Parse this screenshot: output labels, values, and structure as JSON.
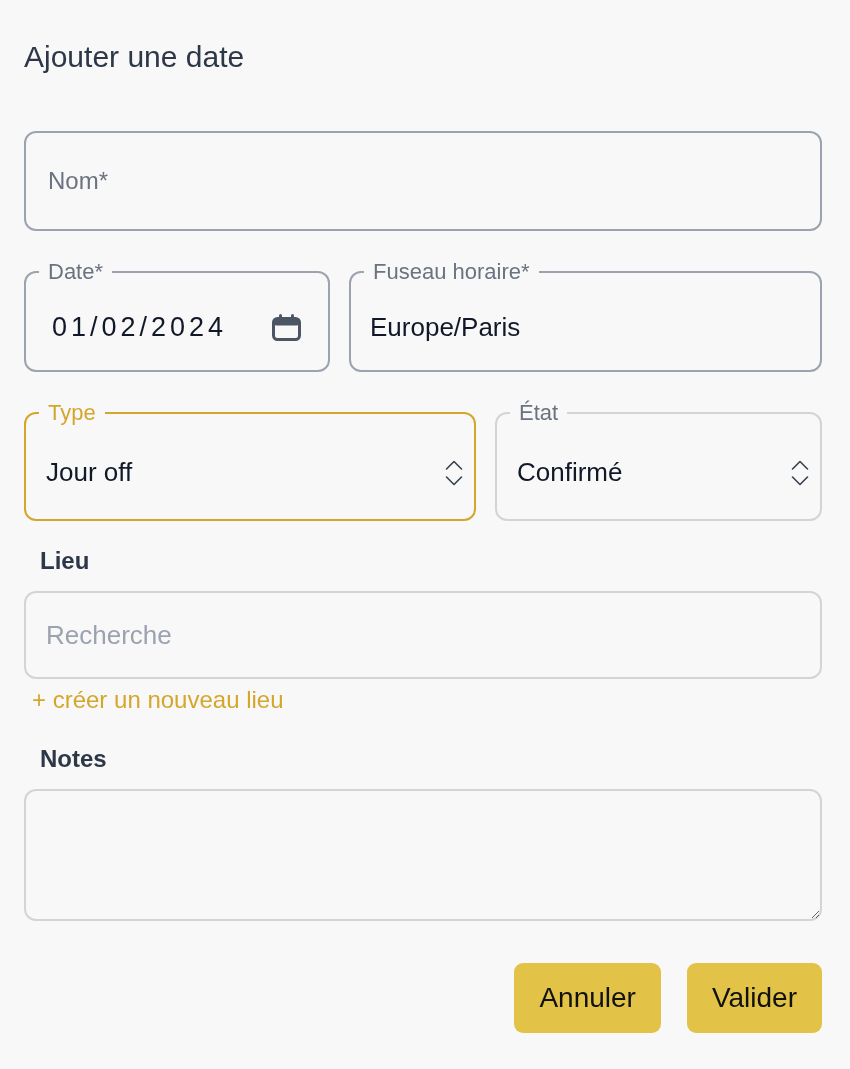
{
  "title": "Ajouter une date",
  "rows": [
    [
      {
        "kind": "text",
        "placeholder": "Nom*",
        "required": true,
        "focused": false
      }
    ],
    [
      {
        "kind": "date",
        "label": "Date*",
        "value": "01/02/2024",
        "required": true,
        "focused": false
      },
      {
        "kind": "text",
        "label": "Fuseau horaire*",
        "value": "Europe/Paris",
        "required": true,
        "focused": false
      }
    ],
    [
      {
        "kind": "select",
        "label": "Type",
        "value": "Jour off",
        "focused": true
      },
      {
        "kind": "select",
        "label": "État",
        "value": "Confirmé",
        "required": false,
        "focused": false
      }
    ]
  ],
  "place": {
    "label": "Lieu",
    "search": {
      "placeholder": "Recherche"
    },
    "create_link": "+ créer un nouveau lieu"
  },
  "notes": {
    "label": "Notes"
  },
  "buttons": [
    "Annuler",
    "Valider"
  ]
}
